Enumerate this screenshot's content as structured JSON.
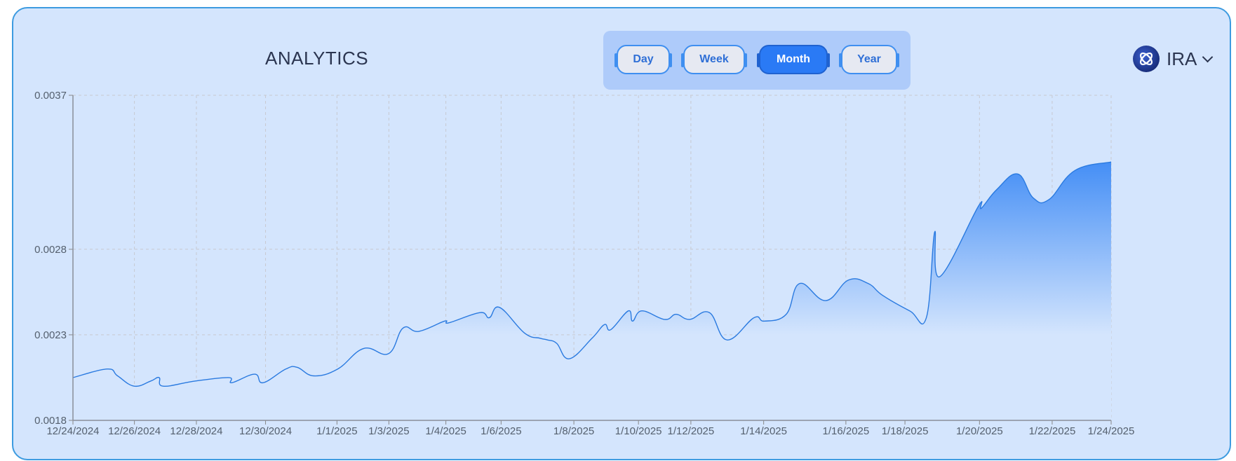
{
  "header": {
    "title": "ANALYTICS"
  },
  "periods": {
    "items": [
      "Day",
      "Week",
      "Month",
      "Year"
    ],
    "selected": "Month"
  },
  "token": {
    "name": "IRA",
    "icon": "token-logo-icon"
  },
  "colors": {
    "line": "#2a7ae0",
    "fill_top": "#3f8bf5",
    "fill_bottom": "#d4e5fd",
    "card": "#d4e5fd",
    "accent": "#2a7af5"
  },
  "chart_data": {
    "type": "area",
    "x_tick_labels": [
      "12/24/2024",
      "12/26/2024",
      "12/28/2024",
      "12/30/2024",
      "1/1/2025",
      "1/3/2025",
      "1/4/2025",
      "1/6/2025",
      "1/8/2025",
      "1/10/2025",
      "1/12/2025",
      "1/14/2025",
      "1/16/2025",
      "1/18/2025",
      "1/20/2025",
      "1/22/2025",
      "1/24/2025"
    ],
    "x_tick_positions": [
      0,
      0.0592,
      0.1189,
      0.1855,
      0.2543,
      0.3043,
      0.3592,
      0.4124,
      0.4825,
      0.5447,
      0.5952,
      0.6653,
      0.7445,
      0.8014,
      0.8732,
      0.9432,
      1.0
    ],
    "y_ticks": [
      0.0018,
      0.0023,
      0.0028,
      0.0037
    ],
    "ylim": [
      0.0018,
      0.0037
    ],
    "grid": true,
    "series": [
      {
        "points": [
          [
            0.0,
            0.00205
          ],
          [
            0.033,
            0.0021
          ],
          [
            0.043,
            0.00206
          ],
          [
            0.059,
            0.002
          ],
          [
            0.075,
            0.00203
          ],
          [
            0.083,
            0.00205
          ],
          [
            0.087,
            0.002
          ],
          [
            0.118,
            0.00203
          ],
          [
            0.15,
            0.00205
          ],
          [
            0.153,
            0.00202
          ],
          [
            0.175,
            0.00207
          ],
          [
            0.183,
            0.00202
          ],
          [
            0.205,
            0.0021
          ],
          [
            0.216,
            0.00211
          ],
          [
            0.232,
            0.00206
          ],
          [
            0.255,
            0.0021
          ],
          [
            0.28,
            0.00222
          ],
          [
            0.304,
            0.00219
          ],
          [
            0.318,
            0.00234
          ],
          [
            0.333,
            0.00232
          ],
          [
            0.358,
            0.00238
          ],
          [
            0.362,
            0.00237
          ],
          [
            0.392,
            0.00243
          ],
          [
            0.401,
            0.0024
          ],
          [
            0.411,
            0.00246
          ],
          [
            0.435,
            0.00231
          ],
          [
            0.45,
            0.00228
          ],
          [
            0.457,
            0.00227
          ],
          [
            0.466,
            0.00225
          ],
          [
            0.478,
            0.00216
          ],
          [
            0.5,
            0.00228
          ],
          [
            0.512,
            0.00236
          ],
          [
            0.518,
            0.00233
          ],
          [
            0.535,
            0.00244
          ],
          [
            0.539,
            0.00238
          ],
          [
            0.548,
            0.00244
          ],
          [
            0.57,
            0.00239
          ],
          [
            0.581,
            0.00242
          ],
          [
            0.594,
            0.00239
          ],
          [
            0.613,
            0.00243
          ],
          [
            0.63,
            0.00227
          ],
          [
            0.656,
            0.0024
          ],
          [
            0.666,
            0.00238
          ],
          [
            0.687,
            0.00242
          ],
          [
            0.7,
            0.0026
          ],
          [
            0.725,
            0.0025
          ],
          [
            0.747,
            0.00262
          ],
          [
            0.766,
            0.0026
          ],
          [
            0.78,
            0.00253
          ],
          [
            0.806,
            0.00244
          ],
          [
            0.822,
            0.0024
          ],
          [
            0.83,
            0.0029
          ],
          [
            0.835,
            0.00264
          ],
          [
            0.872,
            0.00305
          ],
          [
            0.875,
            0.00304
          ],
          [
            0.89,
            0.00315
          ],
          [
            0.91,
            0.00324
          ],
          [
            0.925,
            0.0031
          ],
          [
            0.94,
            0.00309
          ],
          [
            0.965,
            0.00326
          ],
          [
            1.0,
            0.00331
          ]
        ]
      }
    ]
  }
}
